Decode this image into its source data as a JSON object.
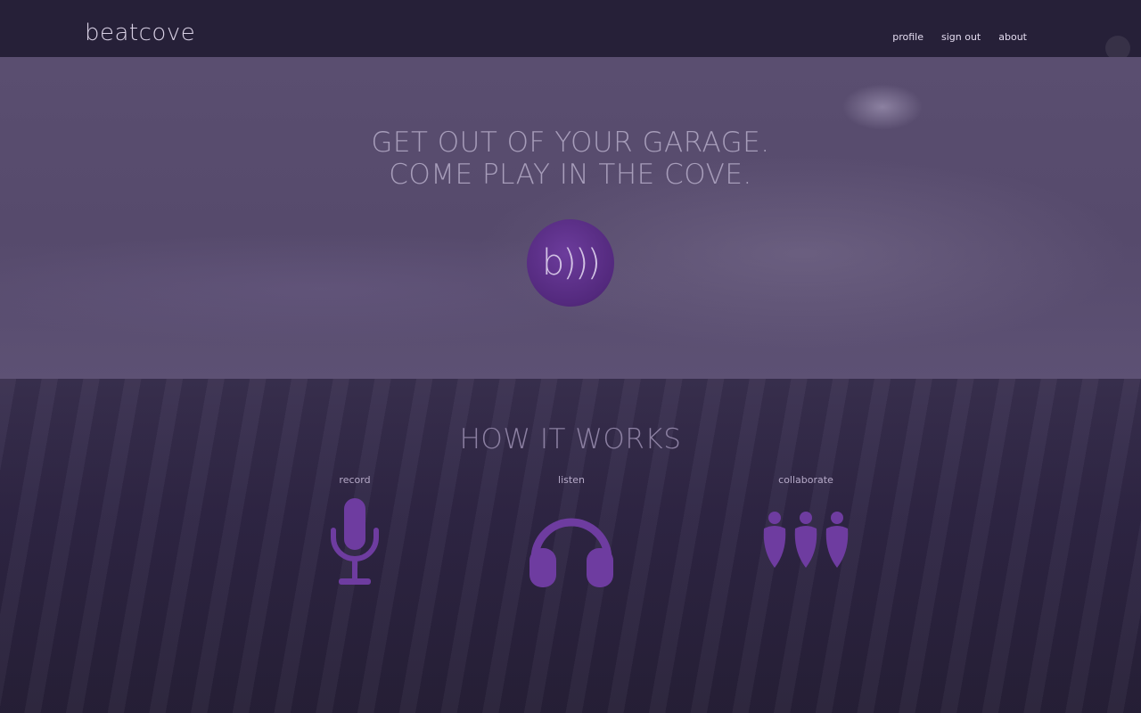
{
  "brand": {
    "logo_text": "beatcove"
  },
  "nav": {
    "links": [
      {
        "label": "profile"
      },
      {
        "label": "sign out"
      },
      {
        "label": "about"
      }
    ]
  },
  "hero": {
    "heading_line1": "GET OUT OF YOUR GARAGE.",
    "heading_line2": "COME PLAY IN THE COVE.",
    "badge_text": "b)))"
  },
  "how_it_works": {
    "title": "HOW IT WORKS",
    "steps": [
      {
        "label": "record",
        "icon": "microphone-icon"
      },
      {
        "label": "listen",
        "icon": "headphones-icon"
      },
      {
        "label": "collaborate",
        "icon": "people-icon"
      }
    ]
  },
  "colors": {
    "accent": "#6e3ca0",
    "navbar": "#262038",
    "hero_overlay": "#5a4e70",
    "background": "#2a2240"
  }
}
